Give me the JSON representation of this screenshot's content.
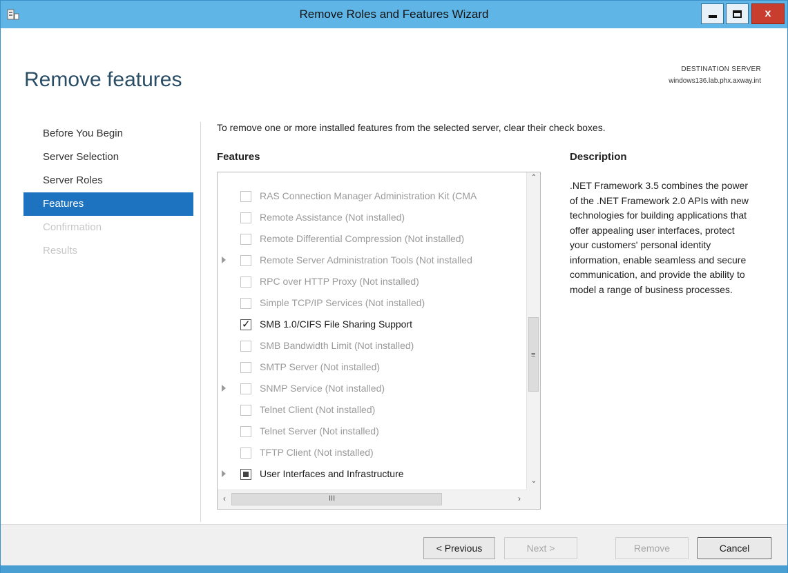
{
  "window": {
    "title": "Remove Roles and Features Wizard",
    "close_glyph": "x",
    "icons": [
      "server-manager-icon",
      "minimize-icon",
      "maximize-icon",
      "close-icon"
    ]
  },
  "header": {
    "page_title": "Remove features",
    "destination_label": "DESTINATION SERVER",
    "destination_value": "windows136.lab.phx.axway.int"
  },
  "nav": {
    "items": [
      {
        "label": "Before You Begin",
        "state": "normal"
      },
      {
        "label": "Server Selection",
        "state": "normal"
      },
      {
        "label": "Server Roles",
        "state": "normal"
      },
      {
        "label": "Features",
        "state": "active"
      },
      {
        "label": "Confirmation",
        "state": "disabled"
      },
      {
        "label": "Results",
        "state": "disabled"
      }
    ]
  },
  "main": {
    "instruction": "To remove one or more installed features from the selected server, clear their check boxes.",
    "features_heading": "Features",
    "features": [
      {
        "label": "RAS Connection Manager Administration Kit (CMA",
        "expandable": false,
        "state": "unchecked",
        "enabled": false
      },
      {
        "label": "Remote Assistance (Not installed)",
        "expandable": false,
        "state": "unchecked",
        "enabled": false
      },
      {
        "label": "Remote Differential Compression (Not installed)",
        "expandable": false,
        "state": "unchecked",
        "enabled": false
      },
      {
        "label": "Remote Server Administration Tools (Not installed",
        "expandable": true,
        "state": "unchecked",
        "enabled": false
      },
      {
        "label": "RPC over HTTP Proxy (Not installed)",
        "expandable": false,
        "state": "unchecked",
        "enabled": false
      },
      {
        "label": "Simple TCP/IP Services (Not installed)",
        "expandable": false,
        "state": "unchecked",
        "enabled": false
      },
      {
        "label": "SMB 1.0/CIFS File Sharing Support",
        "expandable": false,
        "state": "checked",
        "enabled": true
      },
      {
        "label": "SMB Bandwidth Limit (Not installed)",
        "expandable": false,
        "state": "unchecked",
        "enabled": false
      },
      {
        "label": "SMTP Server (Not installed)",
        "expandable": false,
        "state": "unchecked",
        "enabled": false
      },
      {
        "label": "SNMP Service (Not installed)",
        "expandable": true,
        "state": "unchecked",
        "enabled": false
      },
      {
        "label": "Telnet Client (Not installed)",
        "expandable": false,
        "state": "unchecked",
        "enabled": false
      },
      {
        "label": "Telnet Server (Not installed)",
        "expandable": false,
        "state": "unchecked",
        "enabled": false
      },
      {
        "label": "TFTP Client (Not installed)",
        "expandable": false,
        "state": "unchecked",
        "enabled": false
      },
      {
        "label": "User Interfaces and Infrastructure",
        "expandable": true,
        "state": "indeterminate",
        "enabled": true
      }
    ],
    "description_heading": "Description",
    "description_text": ".NET Framework 3.5 combines the power of the .NET Framework 2.0 APIs with new technologies for building applications that offer appealing user interfaces, protect your customers' personal identity information, enable seamless and secure communication, and provide the ability to model a range of business processes."
  },
  "footer": {
    "previous_label": "< Previous",
    "next_label": "Next >",
    "remove_label": "Remove",
    "cancel_label": "Cancel"
  },
  "colors": {
    "title_bar": "#5fb6e6",
    "nav_active": "#1e73c0",
    "heading": "#2a4d66",
    "close_button": "#c93d2e"
  }
}
